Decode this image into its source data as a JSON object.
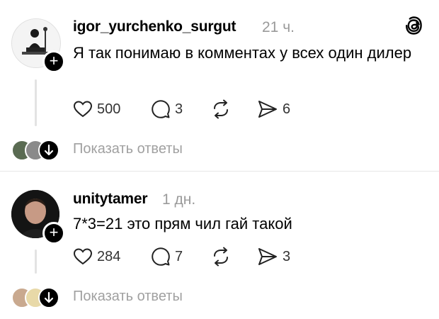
{
  "posts": [
    {
      "username": "igor_yurchenko_surgut",
      "time": "21 ч.",
      "text": "Я так понимаю в комментах у всех один дилер",
      "likes": "500",
      "comments": "3",
      "reposts": "",
      "shares": "6",
      "show_replies": "Показать ответы"
    },
    {
      "username": "unitytamer",
      "time": "1 дн.",
      "text": "7*3=21 это прям чил гай такой",
      "likes": "284",
      "comments": "7",
      "reposts": "",
      "shares": "3",
      "show_replies": "Показать ответы"
    }
  ],
  "icons": {
    "logo": "threads-logo-icon",
    "like": "heart-icon",
    "comment": "comment-bubble-icon",
    "repost": "repost-icon",
    "share": "send-icon",
    "follow": "plus-icon",
    "expand": "arrow-down-icon"
  },
  "colors": {
    "text": "#000000",
    "muted": "#9a9a9a",
    "divider": "#e6e6e6"
  }
}
